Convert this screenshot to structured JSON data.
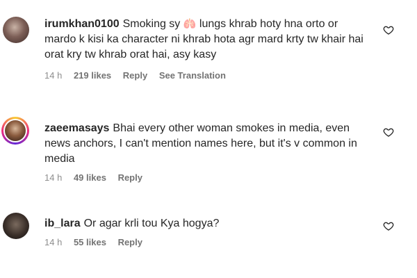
{
  "comments": [
    {
      "username": "irumkhan0100",
      "text_before": "Smoking sy",
      "emoji": "🫁",
      "text_after": "lungs khrab hoty hna orto or mardo k kisi ka character ni khrab hota agr mard krty tw khair hai orat kry tw khrab orat hai, asy kasy",
      "time": "14 h",
      "likes": "219 likes",
      "reply": "Reply",
      "translation": "See Translation"
    },
    {
      "username": "zaeemasays",
      "text": "Bhai every other woman smokes in media, even news anchors, I can't mention names here, but it's v common in media",
      "time": "14 h",
      "likes": "49 likes",
      "reply": "Reply"
    },
    {
      "username": "ib_lara",
      "text": "Or agar krli tou Kya hogya?",
      "time": "14 h",
      "likes": "55 likes",
      "reply": "Reply"
    }
  ],
  "colors": {
    "text": "#262626",
    "meta": "#8e8e8e",
    "story_ring": "#ee2a7b"
  },
  "icons": {
    "like": "heart-outline-icon"
  }
}
